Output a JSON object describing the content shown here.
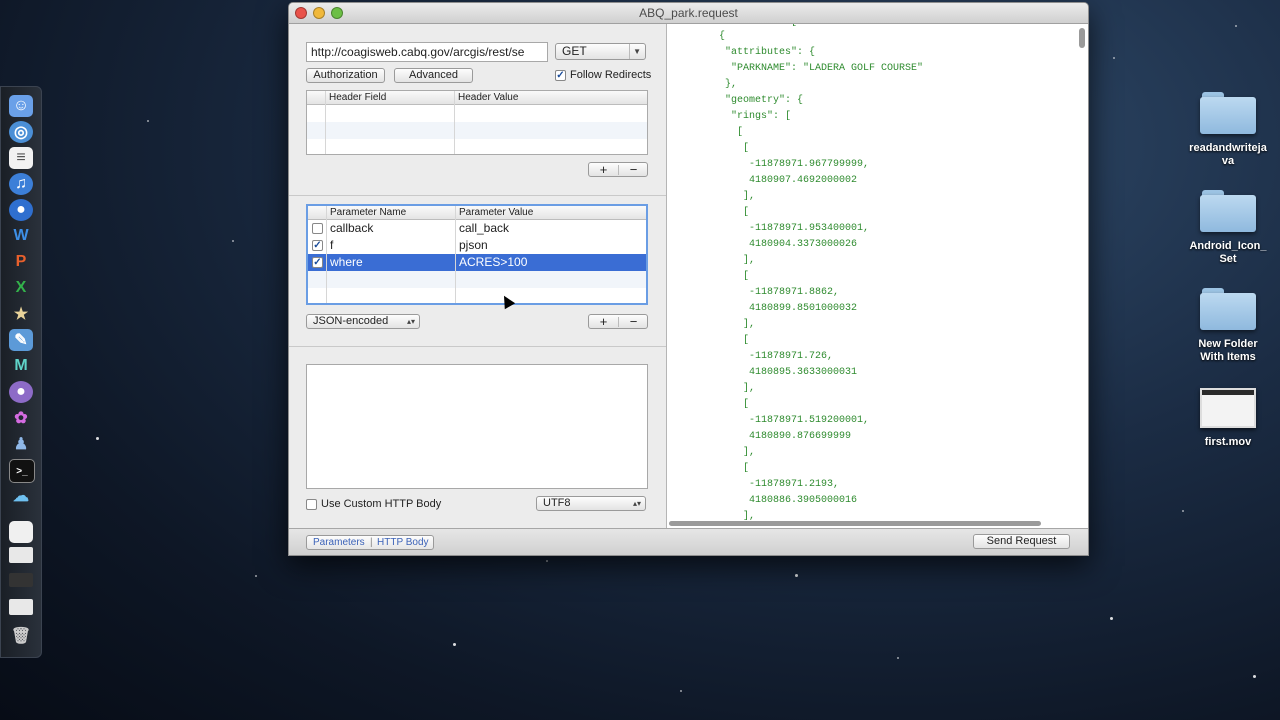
{
  "window": {
    "title": "ABQ_park.request",
    "url": "http://coagisweb.cabq.gov/arcgis/rest/se",
    "method": "GET",
    "authorization_label": "Authorization",
    "advanced_label": "Advanced",
    "follow_redirects_label": "Follow Redirects",
    "follow_redirects_checked": true
  },
  "headers_table": {
    "columns": [
      "Header Field",
      "Header Value"
    ],
    "rows": []
  },
  "params_table": {
    "columns": [
      "Parameter Name",
      "Parameter Value"
    ],
    "rows": [
      {
        "name": "callback",
        "value": "call_back",
        "checked": false
      },
      {
        "name": "f",
        "value": "pjson",
        "checked": true
      },
      {
        "name": "where",
        "value": "ACRES>100",
        "checked": true,
        "selected": true
      }
    ],
    "encoding": "JSON-encoded"
  },
  "body": {
    "use_custom_label": "Use Custom HTTP Body",
    "charset": "UTF8"
  },
  "plus_label": "+",
  "minus_label": "−",
  "bottom": {
    "tab_parameters": "Parameters",
    "tab_separator": "|",
    "tab_body": "HTTP Body",
    "send_label": "Send Request"
  },
  "response_lines": [
    "  {",
    "   \"attributes\": {",
    "    \"PARKNAME\": \"LADERA GOLF COURSE\"",
    "   },",
    "   \"geometry\": {",
    "    \"rings\": [",
    "     [",
    "      [",
    "       -11878971.967799999,",
    "       4180907.4692000002",
    "      ],",
    "      [",
    "       -11878971.953400001,",
    "       4180904.3373000026",
    "      ],",
    "      [",
    "       -11878971.8862,",
    "       4180899.8501000032",
    "      ],",
    "      [",
    "       -11878971.726,",
    "       4180895.3633000031",
    "      ],",
    "      [",
    "       -11878971.519200001,",
    "       4180890.876699999",
    "      ],",
    "      [",
    "       -11878971.2193,",
    "       4180886.3905000016",
    "      ],"
  ],
  "desktop": [
    {
      "label": "readandwritejava",
      "kind": "folder"
    },
    {
      "label": "Android_Icon_Set",
      "kind": "folder"
    },
    {
      "label": "New Folder With Items",
      "kind": "folder"
    },
    {
      "label": "first.mov",
      "kind": "movie"
    }
  ],
  "dock_icons": [
    "finder-icon",
    "safari-icon",
    "textedit-icon",
    "itunes-icon",
    "globe-icon",
    "word-icon",
    "powerpoint-icon",
    "excel-icon",
    "star-icon",
    "xcode-icon",
    "m-app-icon",
    "orb-icon",
    "flower-icon",
    "penguin-icon",
    "terminal-icon",
    "cloud-icon",
    "document-icon",
    "window-icon",
    "disk-icon",
    "window2-icon",
    "trash-icon"
  ],
  "colors": {
    "selection": "#3a6dd4",
    "json_text": "#2e8b2e"
  }
}
